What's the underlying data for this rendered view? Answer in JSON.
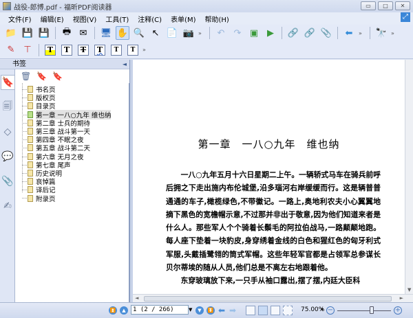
{
  "window": {
    "title": "战役-郎博.pdf - 福昕PDF阅读器",
    "minimize": "▭",
    "maximize": "□",
    "close": "✕"
  },
  "menu": [
    "文件(F)",
    "编辑(E)",
    "视图(V)",
    "工具(T)",
    "注释(C)",
    "表单(M)",
    "帮助(H)"
  ],
  "panel": {
    "title": "书签",
    "collapse": "◄"
  },
  "bookmarks": [
    "书名页",
    "版权页",
    "目录页",
    "第一章 一八○九年 维也纳",
    "第二章 士兵的期待",
    "第三章 战斗第一天",
    "第四章 不眠之夜",
    "第五章 战斗第二天",
    "第六章 无月之夜",
    "第七章 尾声",
    "历史说明",
    "哀悼篇",
    "译后记",
    "附录页"
  ],
  "selected_bookmark": 3,
  "document": {
    "chapter_title": "第一章　一八○九年　维也纳",
    "paragraphs": [
      "一八○九年五月十六日星期二上午。一辆轿式马车在骑兵前呼后拥之下走出施内布伦城堡,沿多瑙河右岸缓缓而行。这是辆普普通通的车子,橄榄绿色,不带徽记。一路上,奥地利农夫小心翼翼地摘下黑色的宽檐帽示意,不过那并非出于敬意,因为他们知道来者是什么人。那些军人个个骑着长鬃毛的阿拉伯战马,一路颠颠地跑。每人座下垫着一块豹皮,身穿绣着金线的白色和猩红色的匈牙利式军服,头戴插鹭翎的筒式军帽。这些年轻军官都是占领军总参谋长贝尔蒂埃的随从人员,他们总是不离左右地跟着他。",
      "东穿玻璃放下来,一只手从袖口露出,摆了摆,内廷大臣科"
    ]
  },
  "status": {
    "page": "1 (2 / 266)",
    "zoom": "75.00%",
    "zoom_slider_percent": 50
  },
  "colors": {
    "accent": "#4a8ed8",
    "selection": "#e3e3e3"
  }
}
